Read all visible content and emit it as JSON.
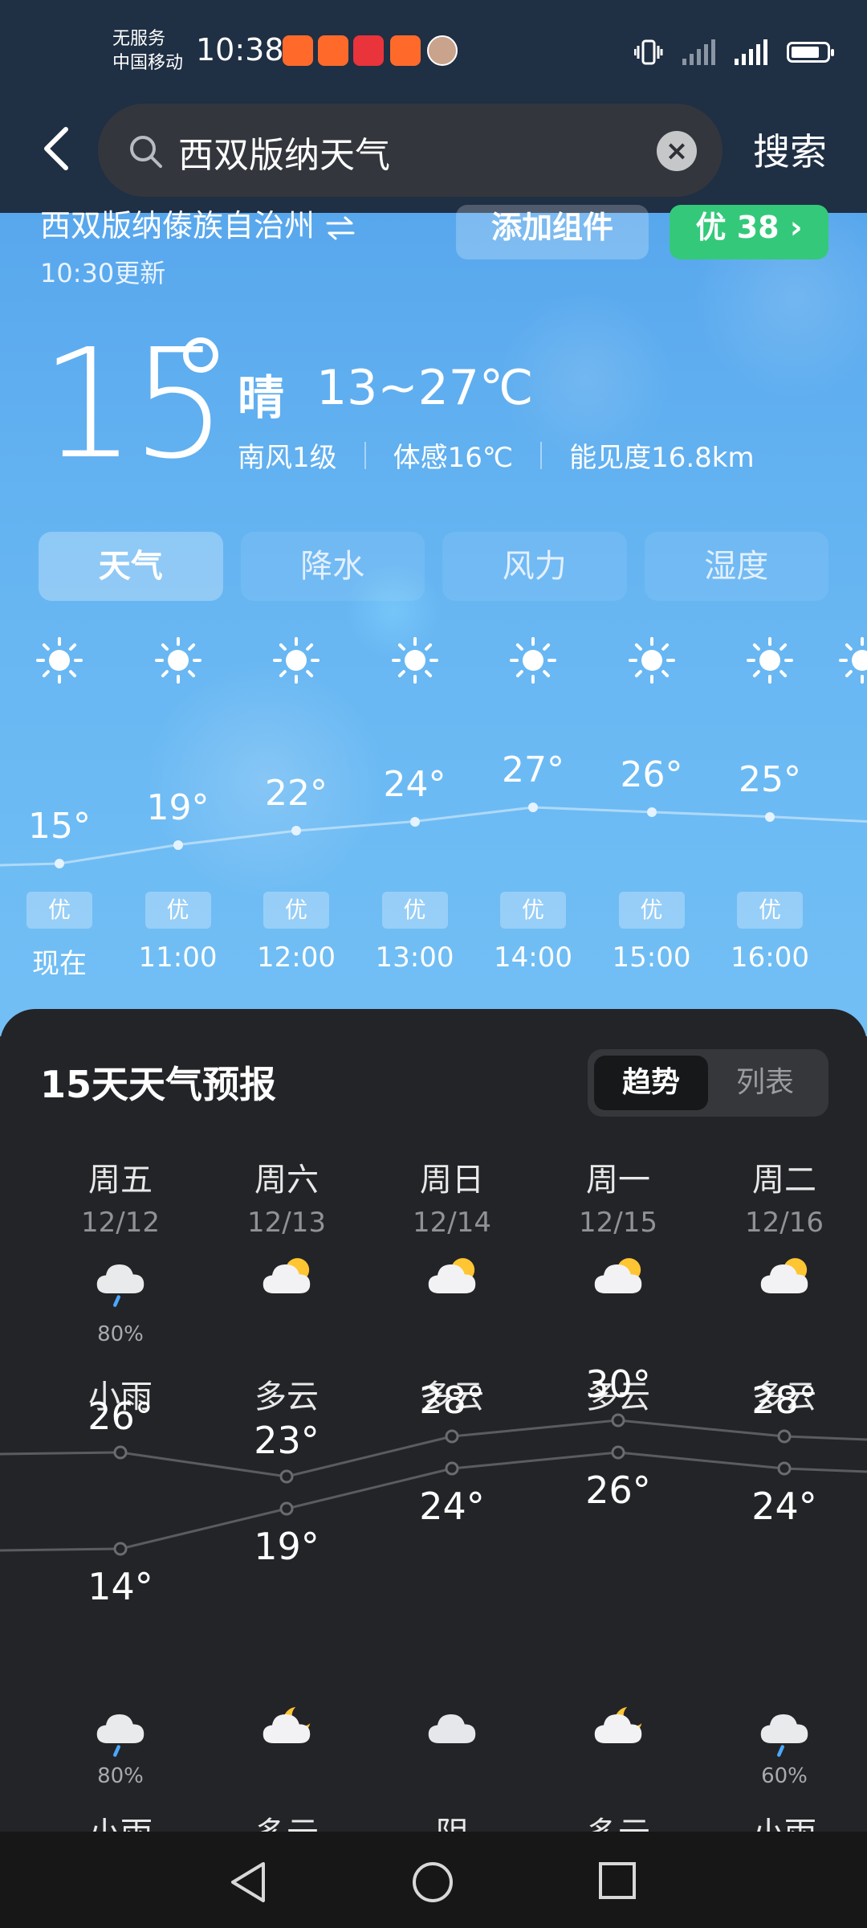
{
  "status_bar": {
    "carrier_line1": "无服务",
    "carrier_line2": "中国移动",
    "time": "10:38"
  },
  "search": {
    "query": "西双版纳天气",
    "button_label": "搜索"
  },
  "location": {
    "name": "西双版纳傣族自治州",
    "updated": "10:30更新",
    "add_widget_label": "添加组件",
    "aqi_label": "优 38 ›"
  },
  "current": {
    "temp": "15",
    "condition": "晴",
    "range": "13~27℃",
    "wind": "南风1级",
    "feels_like": "体感16℃",
    "visibility": "能见度16.8km"
  },
  "tabs": [
    "天气",
    "降水",
    "风力",
    "湿度"
  ],
  "hourly": [
    {
      "time": "现在",
      "temp": "15°",
      "quality": "优",
      "value": 15
    },
    {
      "time": "11:00",
      "temp": "19°",
      "quality": "优",
      "value": 19
    },
    {
      "time": "12:00",
      "temp": "22°",
      "quality": "优",
      "value": 22
    },
    {
      "time": "13:00",
      "temp": "24°",
      "quality": "优",
      "value": 24
    },
    {
      "time": "14:00",
      "temp": "27°",
      "quality": "优",
      "value": 27
    },
    {
      "time": "15:00",
      "temp": "26°",
      "quality": "优",
      "value": 26
    },
    {
      "time": "16:00",
      "temp": "25°",
      "quality": "优",
      "value": 25
    }
  ],
  "forecast": {
    "title": "15天天气预报",
    "toggle_trend": "趋势",
    "toggle_list": "列表",
    "days": [
      {
        "name": "周五",
        "date": "12/12",
        "day_icon": "rain-cloud-icon",
        "day_pct": "80%",
        "day_cond": "小雨",
        "high": "26°",
        "low": "14°",
        "high_v": 26,
        "low_v": 14,
        "night_icon": "rain-cloud-icon",
        "night_pct": "80%",
        "night_cond": "小雨"
      },
      {
        "name": "周六",
        "date": "12/13",
        "day_icon": "partly-cloudy-icon",
        "day_pct": "",
        "day_cond": "多云",
        "high": "23°",
        "low": "19°",
        "high_v": 23,
        "low_v": 19,
        "night_icon": "cloudy-night-icon",
        "night_pct": "",
        "night_cond": "多云"
      },
      {
        "name": "周日",
        "date": "12/14",
        "day_icon": "partly-cloudy-icon",
        "day_pct": "",
        "day_cond": "多云",
        "high": "28°",
        "low": "24°",
        "high_v": 28,
        "low_v": 24,
        "night_icon": "cloud-icon",
        "night_pct": "",
        "night_cond": "阴"
      },
      {
        "name": "周一",
        "date": "12/15",
        "day_icon": "partly-cloudy-icon",
        "day_pct": "",
        "day_cond": "多云",
        "high": "30°",
        "low": "26°",
        "high_v": 30,
        "low_v": 26,
        "night_icon": "cloudy-night-icon",
        "night_pct": "",
        "night_cond": "多云"
      },
      {
        "name": "周二",
        "date": "12/16",
        "day_icon": "partly-cloudy-icon",
        "day_pct": "",
        "day_cond": "多云",
        "high": "28°",
        "low": "24°",
        "high_v": 28,
        "low_v": 24,
        "night_icon": "rain-cloud-icon",
        "night_pct": "60%",
        "night_cond": "小雨"
      }
    ]
  }
}
